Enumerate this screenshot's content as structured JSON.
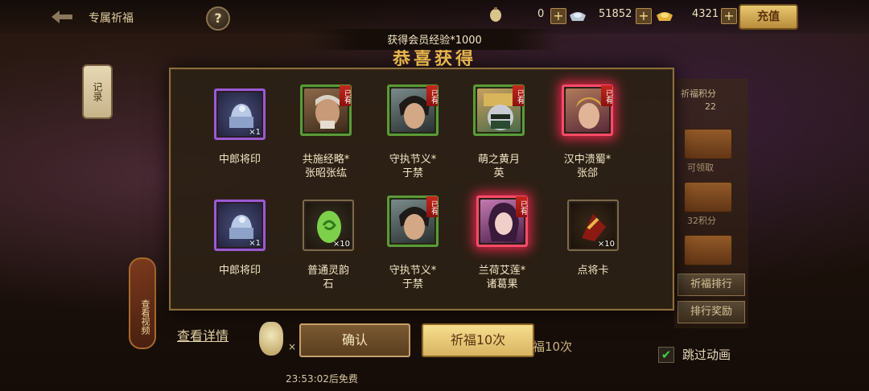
{
  "header": {
    "title": "专属祈福",
    "help_icon": "question-mark-icon",
    "resources": [
      {
        "icon": "lantern-icon",
        "value": "0"
      },
      {
        "icon": "silver-ingot-icon",
        "value": "51852"
      },
      {
        "icon": "gold-ingot-icon",
        "value": "4321"
      }
    ],
    "recharge_label": "充值"
  },
  "left": {
    "record_label": "记录",
    "video_label": "查看视频"
  },
  "right_panel": {
    "points_label": "祈福积分",
    "points_value": "22",
    "chest_note_1": "可领取",
    "chest_note_2": "32积分",
    "ranking_label": "祈福排行",
    "ranking_reward_label": "排行奖励"
  },
  "modal": {
    "banner_text": "获得会员经验*1000",
    "congrats_title": "恭喜获得",
    "owned_tag": "已有",
    "items": [
      {
        "name": "中郎将印",
        "line2": "",
        "quantity": "×1",
        "owned": false,
        "rarity": "purple",
        "icon": "seal-icon"
      },
      {
        "name": "共施经略*",
        "line2": "张昭张纮",
        "quantity": "",
        "owned": true,
        "rarity": "green",
        "icon": "general-portrait-icon"
      },
      {
        "name": "守执节义*",
        "line2": "于禁",
        "quantity": "",
        "owned": true,
        "rarity": "green",
        "icon": "general-portrait-icon"
      },
      {
        "name": "萌之黄月",
        "line2": "英",
        "quantity": "",
        "owned": true,
        "rarity": "green",
        "icon": "general-portrait-icon"
      },
      {
        "name": "汉中溃蜀*",
        "line2": "张郃",
        "quantity": "",
        "owned": true,
        "rarity": "red",
        "icon": "general-portrait-icon"
      },
      {
        "name": "中郎将印",
        "line2": "",
        "quantity": "×1",
        "owned": false,
        "rarity": "purple",
        "icon": "seal-icon"
      },
      {
        "name": "普通灵韵",
        "line2": "石",
        "quantity": "×10",
        "owned": false,
        "rarity": "plain",
        "icon": "jade-stone-icon"
      },
      {
        "name": "守执节义*",
        "line2": "于禁",
        "quantity": "",
        "owned": true,
        "rarity": "green",
        "icon": "general-portrait-icon"
      },
      {
        "name": "兰荷艾莲*",
        "line2": "诸葛果",
        "quantity": "",
        "owned": true,
        "rarity": "red",
        "icon": "general-portrait-icon"
      },
      {
        "name": "点将卡",
        "line2": "",
        "quantity": "×10",
        "owned": false,
        "rarity": "plain",
        "icon": "general-card-icon"
      }
    ]
  },
  "footer": {
    "details_link": "查看详情",
    "confirm_label": "确认",
    "pray10_label": "祈福10次",
    "pray10_ghost": "福10次",
    "x_ghost": "×",
    "timer": "23:53:02后免费",
    "skip_label": "跳过动画",
    "skip_checked": true
  }
}
